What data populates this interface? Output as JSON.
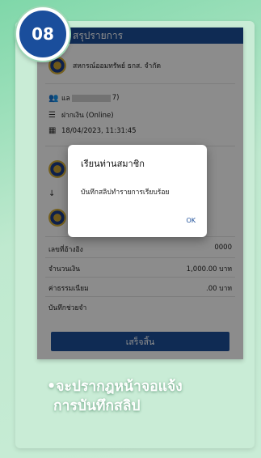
{
  "badge": {
    "number": "08"
  },
  "app": {
    "title": "สรุปรายการ"
  },
  "summary": {
    "coop_name": "สหกรณ์ออมทรัพย์ ธกส. จำกัด",
    "member_prefix": "แล",
    "member_suffix": "7)",
    "transaction_type": "ฝากเงิน (Online)",
    "datetime": "18/04/2023, 11:31:45"
  },
  "details": [
    {
      "label": "เลขที่อ้างอิง",
      "value": "0000"
    },
    {
      "label": "จำนวนเงิน",
      "value": "1,000.00 บาท"
    },
    {
      "label": "ค่าธรรมเนียม",
      "value": ".00 บาท"
    },
    {
      "label": "บันทึกช่วยจำ",
      "value": ""
    }
  ],
  "finish_button": "เสร็จสิ้น",
  "dialog": {
    "title": "เรียนท่านสมาชิก",
    "message": "บันทึกสลิปทำรายการเรียบร้อย",
    "ok": "OK"
  },
  "caption": {
    "line1": "•จะปรากฎหน้าจอแจ้ง",
    "line2": "การบันทึกสลิป"
  },
  "colors": {
    "brand_blue": "#1d4f9a",
    "background_green": "#c9ecd6"
  },
  "icons": {
    "members": "people-icon",
    "type": "list-icon",
    "date": "calendar-icon",
    "arrow": "arrow-down-icon"
  }
}
